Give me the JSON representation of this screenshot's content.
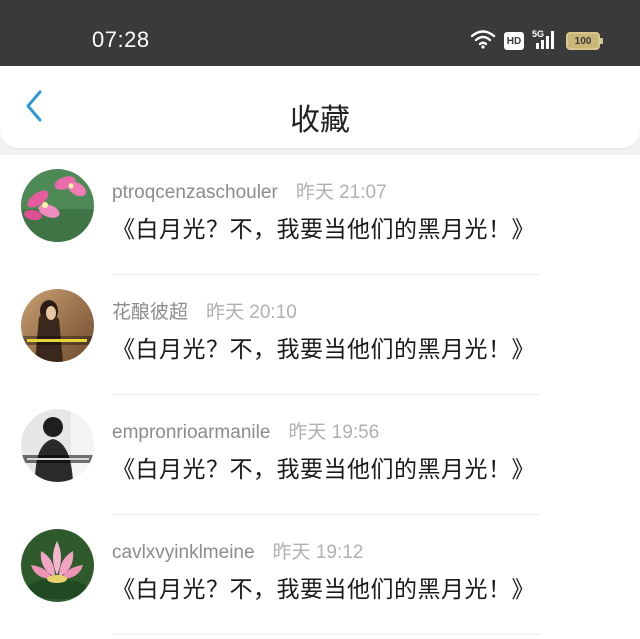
{
  "status_bar": {
    "time": "07:28",
    "hd": "HD",
    "network": "5G",
    "battery": "100",
    "icons": [
      "wifi-icon",
      "hd-icon",
      "signal-5g-icon",
      "battery-icon"
    ]
  },
  "nav": {
    "title": "收藏",
    "back_icon": "chevron-left-icon",
    "accent": "#2d9bd8"
  },
  "favorites": [
    {
      "username": "ptroqcenzaschouler",
      "time": "昨天 21:07",
      "content": "《白月光？不，我要当他们的黑月光！》",
      "avatar": "pink-flower-avatar"
    },
    {
      "username": "花酿彼超",
      "time": "昨天 20:10",
      "content": "《白月光？不，我要当他们的黑月光！》",
      "avatar": "girl-portrait-avatar"
    },
    {
      "username": "empronrioarmanile",
      "time": "昨天 19:56",
      "content": "《白月光？不，我要当他们的黑月光！》",
      "avatar": "monochrome-person-avatar"
    },
    {
      "username": "cavlxvyinklmeine",
      "time": "昨天 19:12",
      "content": "《白月光？不，我要当他们的黑月光！》",
      "avatar": "lotus-avatar"
    }
  ]
}
